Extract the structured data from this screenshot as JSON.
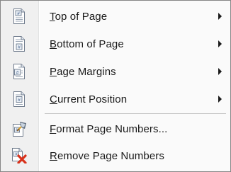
{
  "menu": {
    "items": [
      {
        "pre": "",
        "key": "T",
        "post": "op of Page",
        "submenu": true,
        "icon": "page-top-number-icon"
      },
      {
        "pre": "",
        "key": "B",
        "post": "ottom of Page",
        "submenu": true,
        "icon": "page-bottom-number-icon"
      },
      {
        "pre": "",
        "key": "P",
        "post": "age Margins",
        "submenu": true,
        "icon": "page-margin-number-icon"
      },
      {
        "pre": "",
        "key": "C",
        "post": "urrent Position",
        "submenu": true,
        "icon": "page-current-position-icon"
      },
      {
        "pre": "",
        "key": "F",
        "post": "ormat Page Numbers...",
        "submenu": false,
        "icon": "format-page-numbers-icon"
      },
      {
        "pre": "",
        "key": "R",
        "post": "emove Page Numbers",
        "submenu": false,
        "icon": "remove-page-numbers-icon"
      }
    ]
  },
  "colors": {
    "border": "#868686",
    "background": "#fafafa",
    "gutter": "#f0f0f0",
    "text": "#1a1a1a",
    "remove_x": "#d9311a"
  }
}
